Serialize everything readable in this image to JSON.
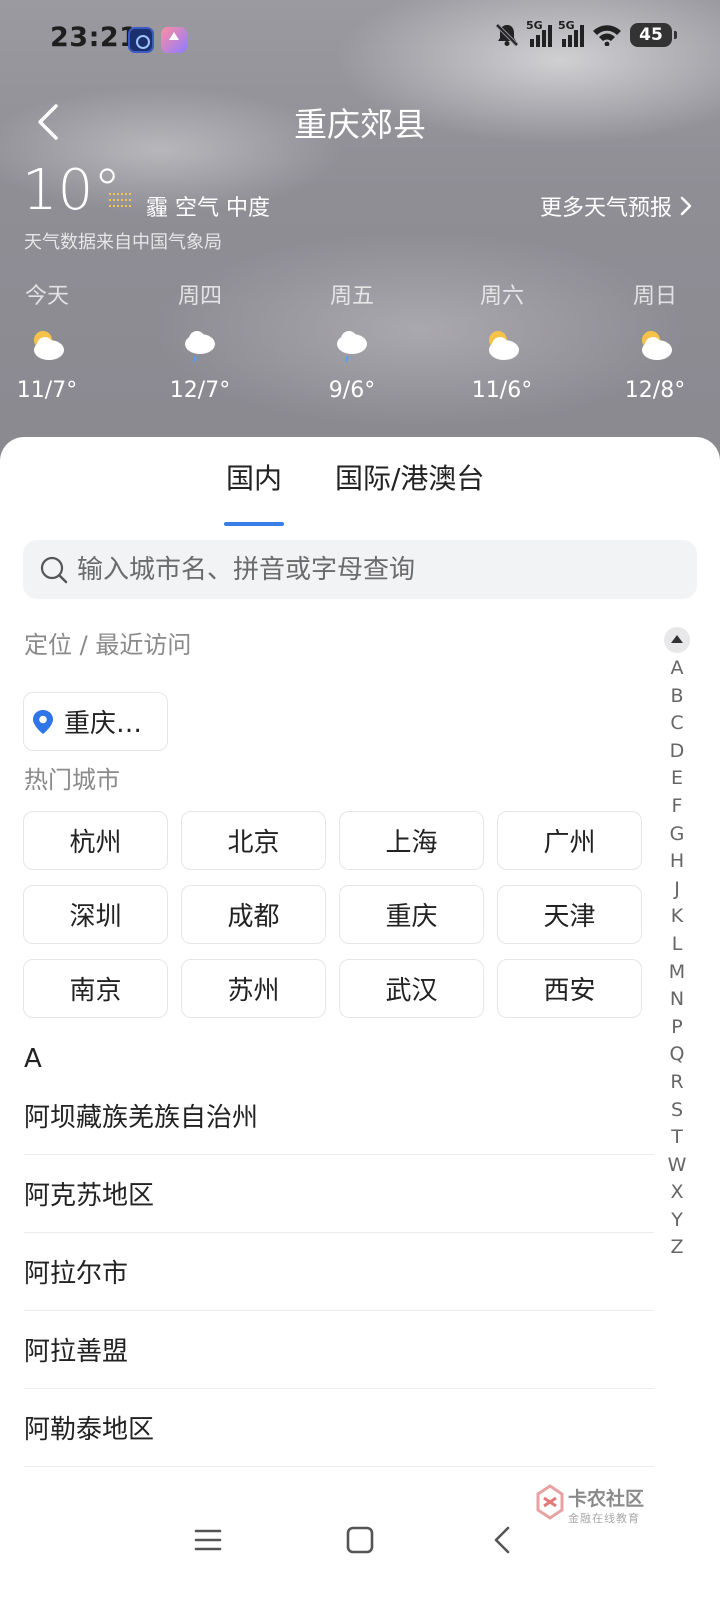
{
  "status_bar": {
    "time": "23:21",
    "network_1": "5G",
    "network_2": "5G",
    "battery": "45"
  },
  "header": {
    "city": "重庆郊县",
    "temperature": "10°",
    "air_quality": "霾 空气 中度",
    "source": "天气数据来自中国气象局",
    "more_forecast": "更多天气预报"
  },
  "forecast": [
    {
      "day": "今天",
      "range": "11/7°",
      "icon": "cloudy-icon"
    },
    {
      "day": "周四",
      "range": "12/7°",
      "icon": "rain-cloud-icon"
    },
    {
      "day": "周五",
      "range": "9/6°",
      "icon": "rain-cloud-icon"
    },
    {
      "day": "周六",
      "range": "11/6°",
      "icon": "cloudy-icon"
    },
    {
      "day": "周日",
      "range": "12/8°",
      "icon": "cloudy-icon"
    }
  ],
  "tabs": {
    "domestic": "国内",
    "international": "国际/港澳台"
  },
  "search": {
    "placeholder": "输入城市名、拼音或字母查询"
  },
  "sections": {
    "recent": "定位 / 最近访问",
    "hot": "热门城市"
  },
  "location_chip": "重庆…",
  "hot_cities": [
    "杭州",
    "北京",
    "上海",
    "广州",
    "深圳",
    "成都",
    "重庆",
    "天津",
    "南京",
    "苏州",
    "武汉",
    "西安"
  ],
  "letter_group": "A",
  "city_list": [
    "阿坝藏族羌族自治州",
    "阿克苏地区",
    "阿拉尔市",
    "阿拉善盟",
    "阿勒泰地区"
  ],
  "index_letters": [
    "A",
    "B",
    "C",
    "D",
    "E",
    "F",
    "G",
    "H",
    "J",
    "K",
    "L",
    "M",
    "N",
    "P",
    "Q",
    "R",
    "S",
    "T",
    "W",
    "X",
    "Y",
    "Z"
  ],
  "watermark": {
    "title": "卡农社区",
    "subtitle": "金融在线教育"
  },
  "colors": {
    "accent": "#3b7de8",
    "sheet_bg": "#ffffff",
    "chip_border": "#e6e6e6"
  }
}
